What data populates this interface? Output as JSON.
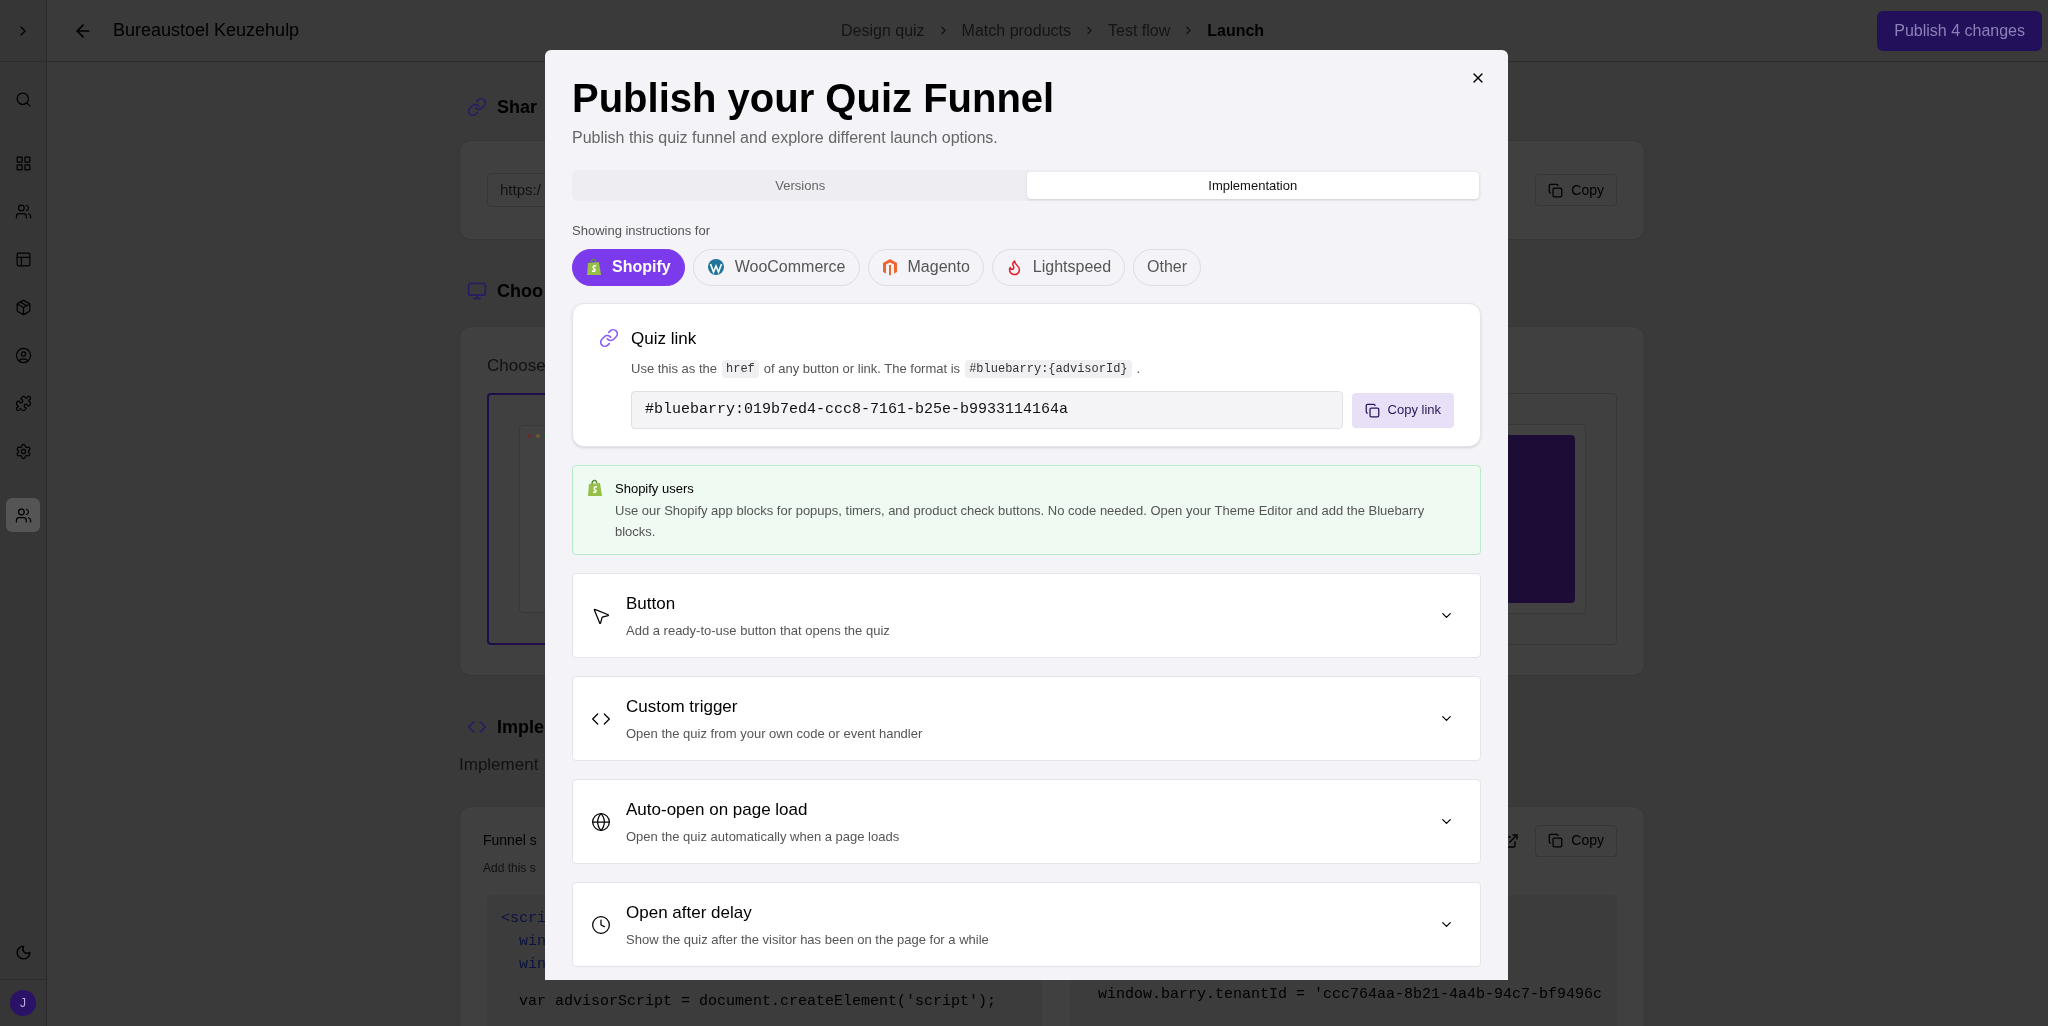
{
  "sidebar": {
    "nav_items": [
      {
        "kind": "search",
        "selected": false
      },
      {
        "kind": "dashboard",
        "selected": false
      },
      {
        "kind": "users",
        "selected": false
      },
      {
        "kind": "layout",
        "selected": false
      },
      {
        "kind": "box",
        "selected": false
      },
      {
        "kind": "profile",
        "selected": false
      },
      {
        "kind": "puzzle",
        "selected": false
      },
      {
        "kind": "settings",
        "selected": false
      },
      {
        "kind": "team",
        "selected": true
      }
    ],
    "avatar": "J"
  },
  "top_bar": {
    "title": "Bureaustoel Keuzehulp",
    "steps": [
      {
        "label": "Design quiz",
        "selected": false
      },
      {
        "label": "Match products",
        "selected": false
      },
      {
        "label": "Test flow",
        "selected": false
      },
      {
        "label": "Launch",
        "selected": true
      }
    ],
    "publish_button": "Publish 4 changes"
  },
  "page": {
    "share": {
      "heading": "Shar",
      "url": "https:/",
      "copy_button": "Copy"
    },
    "choose": {
      "heading": "Choo",
      "text": "Choose"
    },
    "implement": {
      "heading": "Imple",
      "text": "Implement",
      "card_title": "Funnel s",
      "card_text": "Add this s",
      "copy_button": "Copy",
      "code_left": [
        "<scri",
        "win",
        "win",
        "var advisorScript = document.createElement('script');"
      ],
      "code_right": [
        "window.barry.tenantId = 'ccc764aa-8b21-4a4b-94c7-bf9496c"
      ]
    }
  },
  "modal": {
    "title": "Publish your Quiz Funnel",
    "subtitle": "Publish this quiz funnel and explore different launch options.",
    "tabs": [
      {
        "label": "Versions",
        "selected": false
      },
      {
        "label": "Implementation",
        "selected": true
      }
    ],
    "platform_label": "Showing instructions for",
    "platforms": [
      {
        "kind": "shopify",
        "label": "Shopify",
        "selected": true
      },
      {
        "kind": "woocommerce",
        "label": "WooCommerce",
        "selected": false
      },
      {
        "kind": "magento",
        "label": "Magento",
        "selected": false
      },
      {
        "kind": "lightspeed",
        "label": "Lightspeed",
        "selected": false
      },
      {
        "kind": "other",
        "label": "Other",
        "selected": false
      }
    ],
    "quiz_link": {
      "title": "Quiz link",
      "description": [
        {
          "kind": "text",
          "text": "Use this as the"
        },
        {
          "kind": "code",
          "text": "href"
        },
        {
          "kind": "text",
          "text": "of any button or link. The format is"
        },
        {
          "kind": "code",
          "text": "#bluebarry:{advisorId}"
        },
        {
          "kind": "text",
          "text": "."
        }
      ],
      "value": "#bluebarry:019b7ed4-ccc8-7161-b25e-b9933114164a",
      "copy_button": "Copy link"
    },
    "notice": {
      "title": "Shopify users",
      "text": "Use our Shopify app blocks for popups, timers, and product check buttons. No code needed. Open your Theme Editor and add the Bluebarry blocks."
    },
    "options": [
      {
        "kind": "pointer",
        "title": "Button",
        "description": "Add a ready-to-use button that opens the quiz",
        "expanded": false
      },
      {
        "kind": "code",
        "title": "Custom trigger",
        "description": "Open the quiz from your own code or event handler",
        "expanded": false
      },
      {
        "kind": "globe",
        "title": "Auto-open on page load",
        "description": "Open the quiz automatically when a page loads",
        "expanded": false
      },
      {
        "kind": "clock",
        "title": "Open after delay",
        "description": "Show the quiz after the visitor has been on the page for a while",
        "expanded": false
      }
    ]
  }
}
